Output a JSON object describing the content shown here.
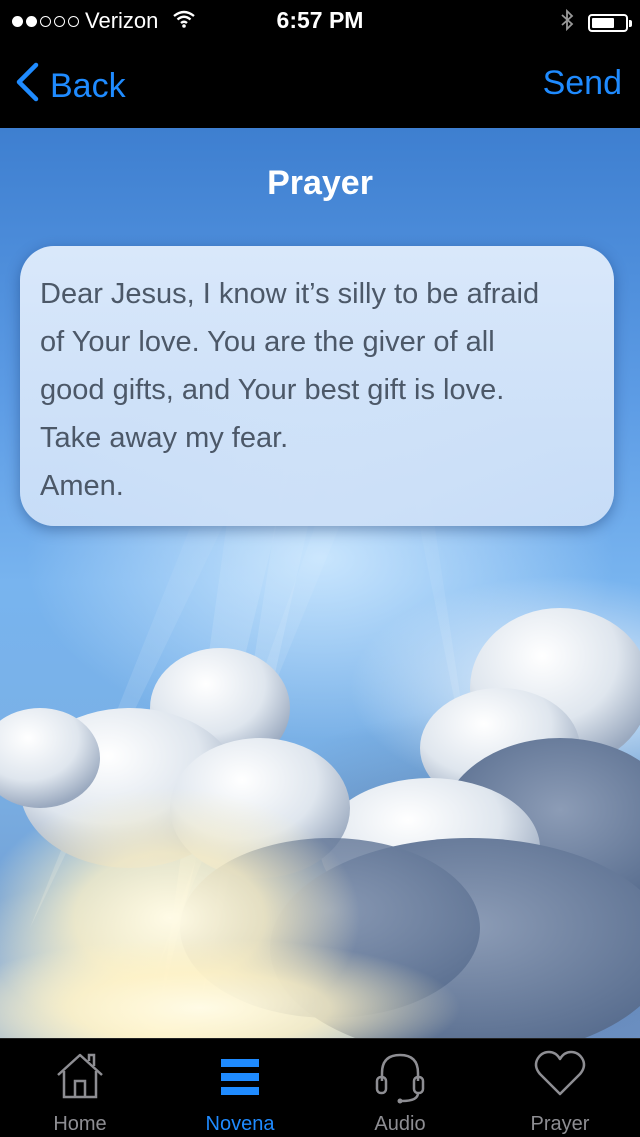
{
  "status_bar": {
    "carrier": "Verizon",
    "time": "6:57 PM"
  },
  "nav": {
    "back_label": "Back",
    "send_label": "Send"
  },
  "page": {
    "title": "Prayer",
    "prayer_lines": [
      "Dear Jesus, I know it’s silly to be afraid",
      "of Your love. You are the giver of all",
      "good gifts, and Your best gift is love.",
      "Take away my fear.",
      "Amen."
    ]
  },
  "tabs": [
    {
      "label": "Home",
      "icon": "house-icon",
      "active": false
    },
    {
      "label": "Novena",
      "icon": "list-icon",
      "active": true
    },
    {
      "label": "Audio",
      "icon": "headset-icon",
      "active": false
    },
    {
      "label": "Prayer",
      "icon": "heart-icon",
      "active": false
    }
  ],
  "colors": {
    "accent": "#1f8bff",
    "tab_inactive": "#8e8e93",
    "prayer_text": "#4c5868"
  }
}
